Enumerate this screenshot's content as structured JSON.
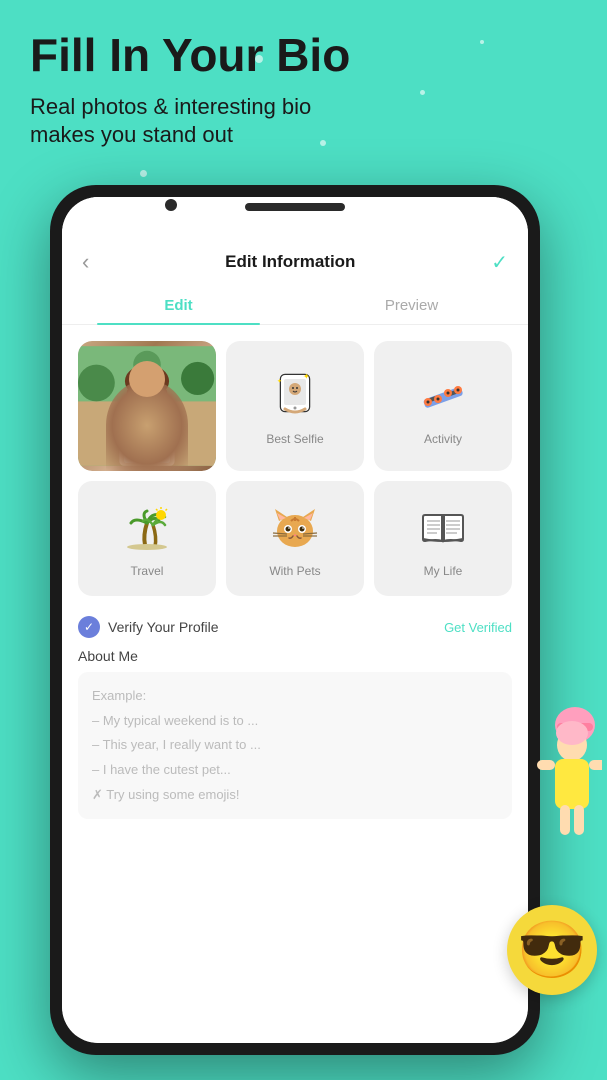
{
  "page": {
    "background_color": "#4DDFC4",
    "title": "Fill In Your Bio",
    "subtitle": "Real photos & interesting bio\nmakes you stand out"
  },
  "phone": {
    "nav": {
      "back_icon": "‹",
      "title": "Edit Information",
      "check_icon": "✓"
    },
    "tabs": [
      {
        "label": "Edit",
        "active": true
      },
      {
        "label": "Preview",
        "active": false
      }
    ],
    "photo_cells": [
      {
        "type": "user_photo",
        "label": ""
      },
      {
        "type": "icon",
        "icon": "selfie",
        "label": "Best Selfie"
      },
      {
        "type": "icon",
        "icon": "skateboard",
        "label": "Activity"
      },
      {
        "type": "icon",
        "icon": "travel",
        "label": "Travel"
      },
      {
        "type": "icon",
        "icon": "pets",
        "label": "With Pets"
      },
      {
        "type": "icon",
        "icon": "book",
        "label": "My Life"
      }
    ],
    "verify": {
      "label": "Verify Your Profile",
      "action": "Get Verified"
    },
    "about_me": {
      "label": "About Me",
      "placeholder_lines": [
        "Example:",
        "– My typical weekend is to ...",
        "– This year, I really want to ...",
        "– I have the cutest pet...",
        "✗ Try using some emojis!"
      ]
    }
  },
  "decorations": {
    "emoji": "😎"
  }
}
